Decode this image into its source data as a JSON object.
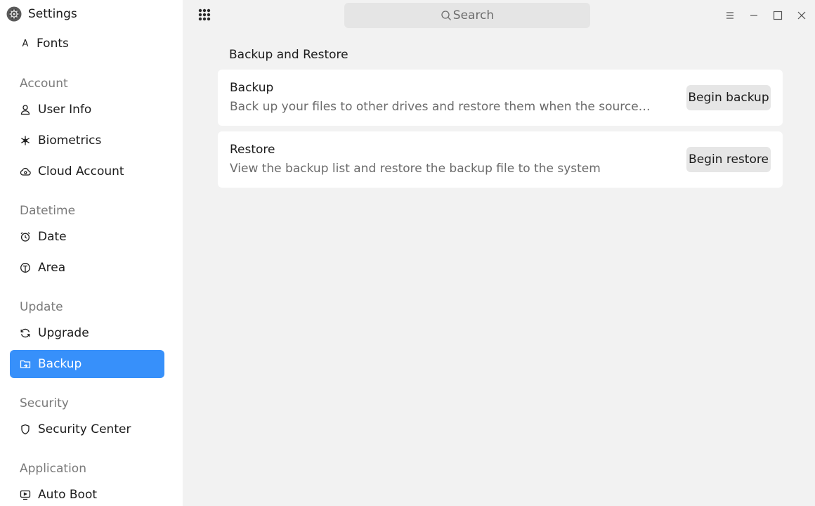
{
  "app": {
    "title": "Settings"
  },
  "sidebar": {
    "partial_item": {
      "label": "Fonts",
      "icon": "font-icon"
    },
    "groups": [
      {
        "label": "Account",
        "items": [
          {
            "label": "User Info",
            "icon": "user-icon"
          },
          {
            "label": "Biometrics",
            "icon": "biometrics-icon"
          },
          {
            "label": "Cloud Account",
            "icon": "cloud-icon"
          }
        ]
      },
      {
        "label": "Datetime",
        "items": [
          {
            "label": "Date",
            "icon": "alarm-clock-icon"
          },
          {
            "label": "Area",
            "icon": "globe-icon"
          }
        ]
      },
      {
        "label": "Update",
        "items": [
          {
            "label": "Upgrade",
            "icon": "refresh-icon"
          },
          {
            "label": "Backup",
            "icon": "backup-folder-icon",
            "active": true
          }
        ]
      },
      {
        "label": "Security",
        "items": [
          {
            "label": "Security Center",
            "icon": "shield-icon"
          }
        ]
      },
      {
        "label": "Application",
        "items": [
          {
            "label": "Auto Boot",
            "icon": "autoboot-icon"
          }
        ]
      }
    ]
  },
  "topbar": {
    "search_placeholder": "Search",
    "icons": [
      "apps-grid-icon",
      "search-icon",
      "menu-icon",
      "minimize-icon",
      "maximize-icon",
      "close-icon"
    ]
  },
  "main": {
    "section_title": "Backup and Restore",
    "cards": [
      {
        "title": "Backup",
        "description": "Back up your files to other drives and restore them when the source files are lost, damaged, or deleted",
        "button": "Begin backup"
      },
      {
        "title": "Restore",
        "description": "View the backup list and restore the backup file to the system",
        "button": "Begin restore"
      }
    ]
  },
  "colors": {
    "accent": "#3790fa",
    "background": "#f2f2f2",
    "sidebar": "#ffffff",
    "button": "#e6e6e6"
  }
}
